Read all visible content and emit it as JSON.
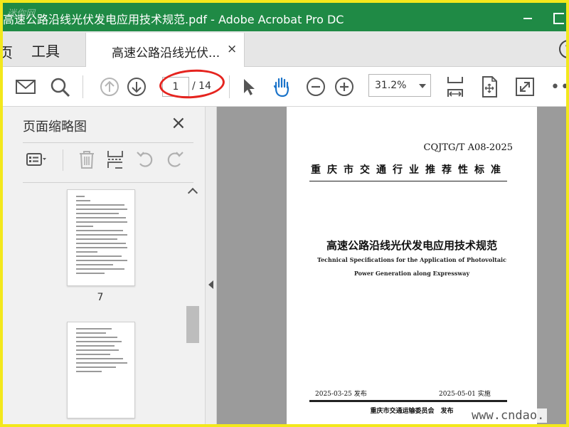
{
  "window": {
    "title": "高速公路沿线光伏发电应用技术规范.pdf - Adobe Acrobat Pro DC",
    "logo_mark": "迷你网",
    "accent": "#1f8a45"
  },
  "tabs": {
    "home": "页",
    "tools": "工具",
    "document": "高速公路沿线光伏...",
    "close": "×",
    "help": "?"
  },
  "toolbar": {
    "icons": [
      "mail-icon",
      "search-icon",
      "page-up-icon",
      "page-down-icon",
      "select-arrow-icon",
      "hand-tool-icon",
      "zoom-out-icon",
      "zoom-in-icon",
      "fit-width-icon",
      "rotate-page-icon",
      "fullscreen-icon",
      "more-icon"
    ],
    "page_current": "1",
    "page_total": "/ 14",
    "zoom": "31.2%",
    "more": "•••"
  },
  "side_panel": {
    "title": "页面缩略图",
    "close": "×",
    "thumbnail_label": "7",
    "icons": [
      "options-icon",
      "delete-icon",
      "insert-page-icon",
      "undo-icon",
      "redo-icon"
    ]
  },
  "document": {
    "code": "CQJTG/T A08-2025",
    "standard_type": "重庆市交通行业推荐性标准",
    "title_cn": "高速公路沿线光伏发电应用技术规范",
    "title_en_line1": "Technical Specifications for the Application of Photovoltaic",
    "title_en_line2": "Power Generation along Expressway",
    "issue_date": "2025-03-25 发布",
    "implement_date": "2025-05-01 实施",
    "publisher": "重庆市交通运输委员会　发布"
  },
  "watermark": "www.cndao."
}
